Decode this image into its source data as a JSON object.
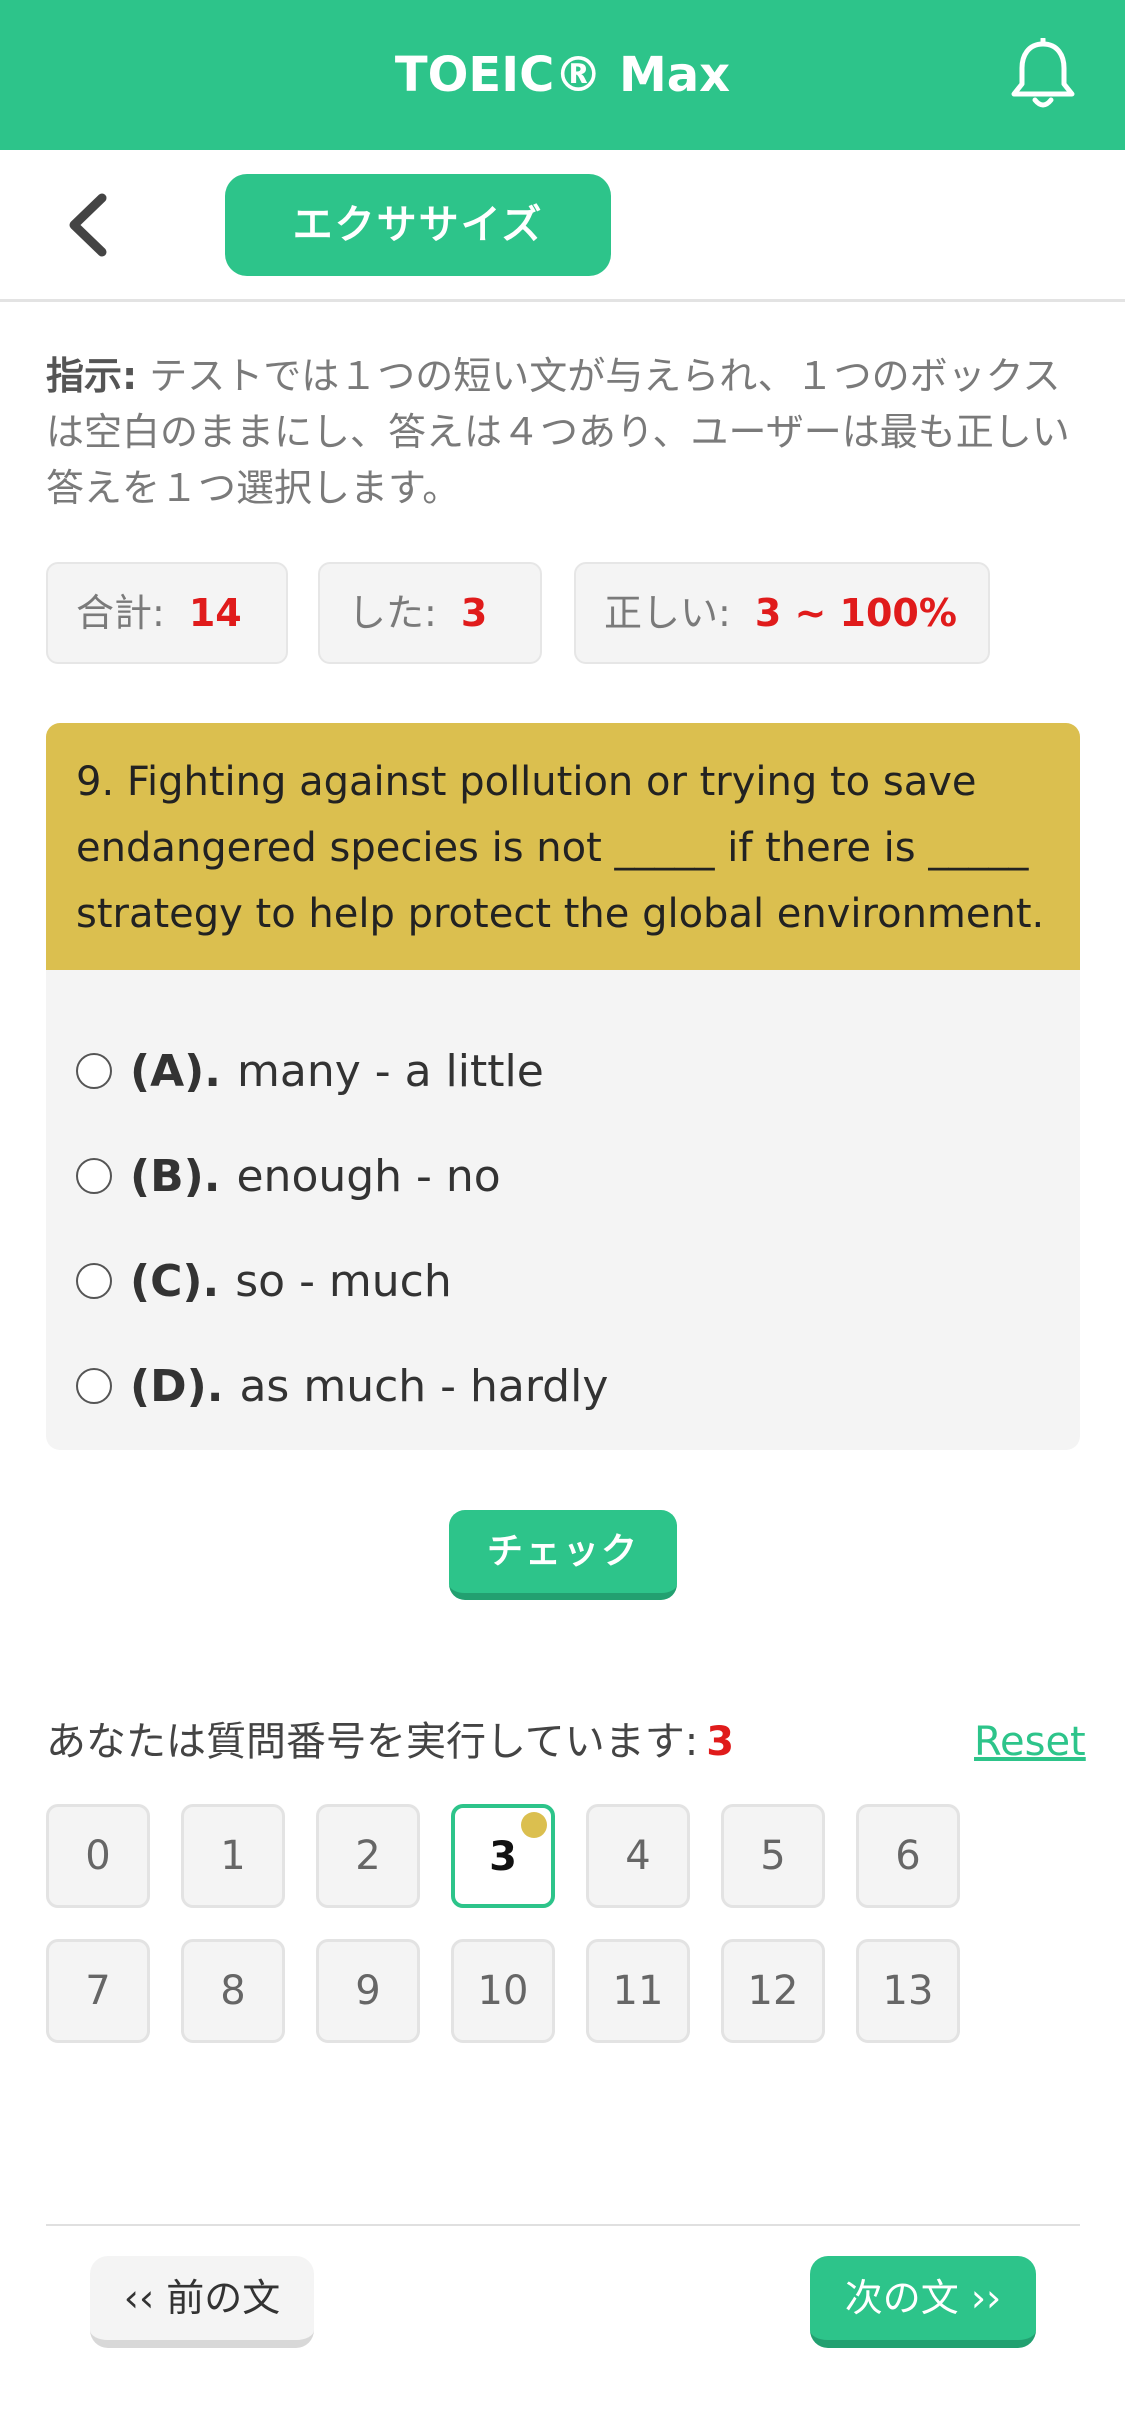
{
  "header": {
    "title": "TOEIC® Max",
    "icon": "bell-icon"
  },
  "subbar": {
    "back_icon": "chevron-left-icon",
    "exercise_label": "エクササイズ"
  },
  "instruction": {
    "label": "指示:",
    "text": " テストでは１つの短い文が与えられ、１つのボックスは空白のままにし、答えは４つあり、ユーザーは最も正しい答えを１つ選択します。"
  },
  "stats": {
    "total": {
      "label": "合計:",
      "value": "14"
    },
    "done": {
      "label": "した:",
      "value": "3"
    },
    "correct": {
      "label": "正しい:",
      "value": "3 ~ 100%"
    }
  },
  "question": {
    "text": "9. Fighting against pollution or trying to save endangered species is not _____ if there is _____ strategy to help protect the global environment.",
    "options": [
      {
        "label": "(A).",
        "text": "many - a little"
      },
      {
        "label": "(B).",
        "text": "enough - no"
      },
      {
        "label": "(C).",
        "text": "so - much"
      },
      {
        "label": "(D).",
        "text": "as much - hardly"
      }
    ]
  },
  "check_label": "チェック",
  "progress": {
    "running_label": "あなたは質問番号を実行しています:",
    "current": "3",
    "reset_label": "Reset",
    "numbers": [
      "0",
      "1",
      "2",
      "3",
      "4",
      "5",
      "6",
      "7",
      "8",
      "9",
      "10",
      "11",
      "12",
      "13"
    ]
  },
  "nav": {
    "prev_label": "‹‹ 前の文",
    "next_label": "次の文 ››"
  },
  "colors": {
    "accent": "#2dc48a",
    "question_header": "#dbbf4f",
    "highlight": "#e01b1b"
  }
}
